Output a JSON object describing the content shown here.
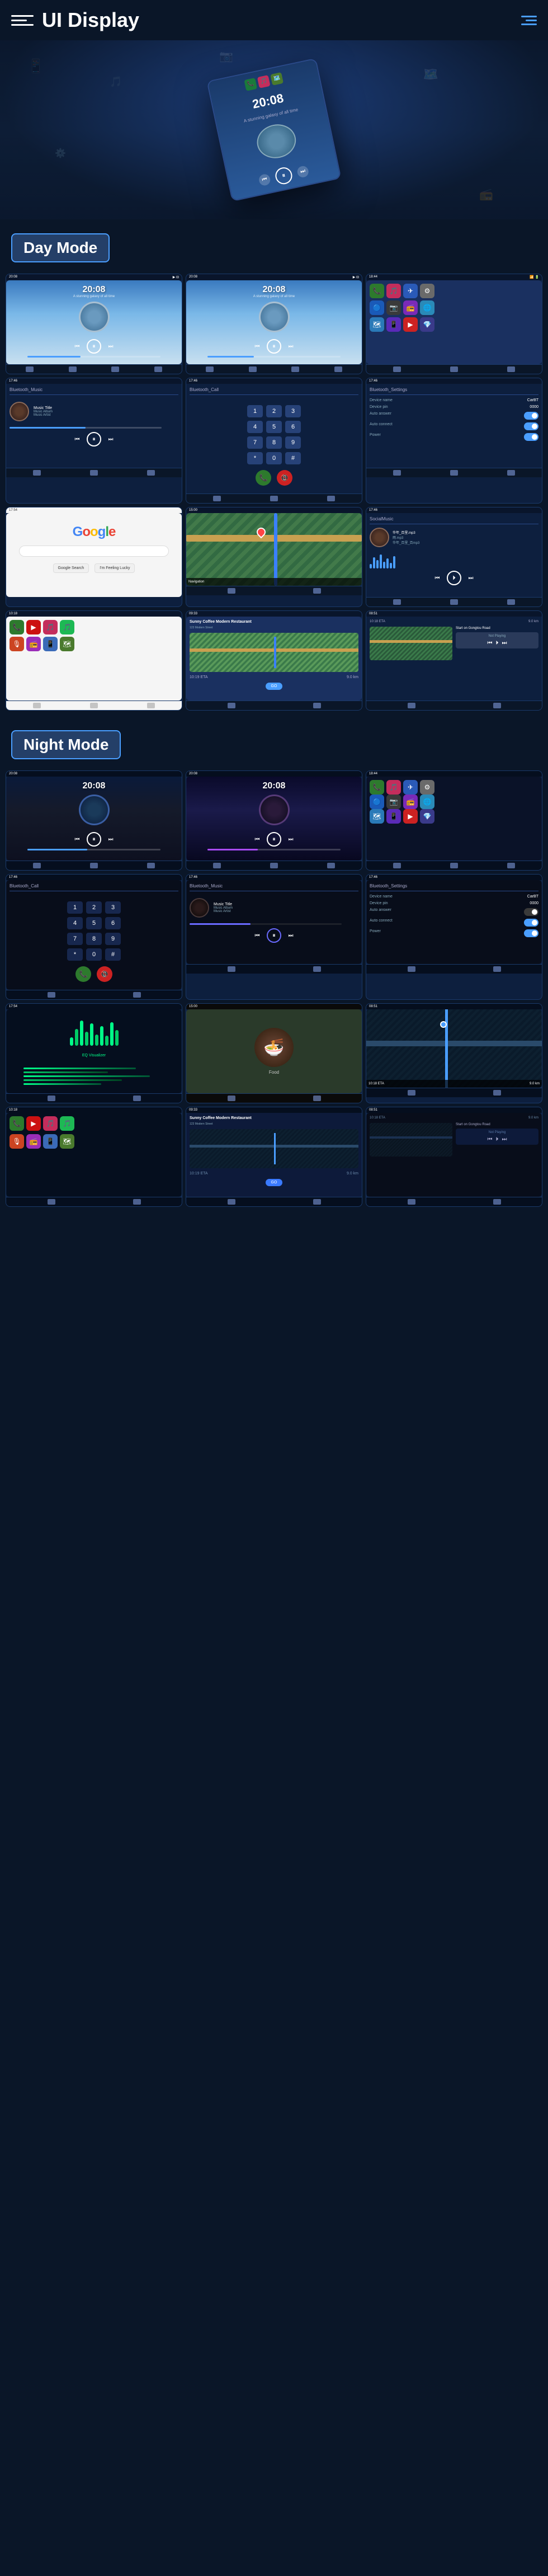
{
  "header": {
    "title": "UI Display",
    "menu_label": "menu",
    "nav_label": "navigation"
  },
  "sections": {
    "day_mode": "Day Mode",
    "night_mode": "Night Mode"
  },
  "hero": {
    "time": "20:08",
    "subtitle": "A stunning galaxy of all time"
  },
  "day_screens": [
    {
      "type": "music_player",
      "time": "20:08",
      "subtitle": "A stunning galaxy of all time"
    },
    {
      "type": "music_player",
      "time": "20:08",
      "subtitle": "A stunning galaxy of all time"
    },
    {
      "type": "app_grid"
    },
    {
      "type": "bluetooth_music",
      "header": "Bluetooth_Music"
    },
    {
      "type": "bluetooth_call",
      "header": "Bluetooth_Call"
    },
    {
      "type": "bluetooth_settings",
      "header": "Bluetooth_Settings",
      "device_name": "CarBT",
      "device_pin": "0000",
      "auto_answer": "Auto answer",
      "auto_connect": "Auto connect",
      "power": "Power"
    },
    {
      "type": "google",
      "label": "Google"
    },
    {
      "type": "map_navigation"
    },
    {
      "type": "social_music",
      "header": "SocialMusic"
    },
    {
      "type": "app_launcher_day"
    },
    {
      "type": "restaurant_map"
    },
    {
      "type": "navigation_day"
    }
  ],
  "night_screens": [
    {
      "type": "night_music_player",
      "time": "20:08"
    },
    {
      "type": "night_music_player2",
      "time": "20:08"
    },
    {
      "type": "night_app_grid"
    },
    {
      "type": "night_bluetooth_call",
      "header": "Bluetooth_Call"
    },
    {
      "type": "night_bluetooth_music",
      "header": "Bluetooth_Music"
    },
    {
      "type": "night_bluetooth_settings",
      "header": "Bluetooth_Settings"
    },
    {
      "type": "night_audio_viz"
    },
    {
      "type": "night_food"
    },
    {
      "type": "night_map_nav"
    },
    {
      "type": "night_app_launcher"
    },
    {
      "type": "night_restaurant_map"
    },
    {
      "type": "night_navigation"
    }
  ],
  "music": {
    "title": "Music Title",
    "album": "Music Album",
    "artist": "Music Artist"
  },
  "bluetooth": {
    "device_name_label": "Device name",
    "device_name_value": "CarBT",
    "device_pin_label": "Device pin",
    "device_pin_value": "0000",
    "auto_answer": "Auto answer",
    "auto_connect": "Auto connect",
    "power": "Power"
  },
  "social": {
    "items": [
      "华年_百里.mp3",
      "雨.mp3",
      "华年_百里_百mp3"
    ]
  },
  "restaurant": {
    "name": "Sunny Coffee Modern Restaurant",
    "address": "123 Modern Street",
    "eta_label": "10:19 ETA",
    "distance": "9.0 km",
    "go_button": "GO"
  },
  "navigation": {
    "start": "Start on Gongtou Road",
    "not_playing": "Not Playing"
  },
  "phone_keys": [
    "1",
    "2",
    "3",
    "4",
    "5",
    "6",
    "7",
    "8",
    "9",
    "*",
    "0",
    "#"
  ]
}
